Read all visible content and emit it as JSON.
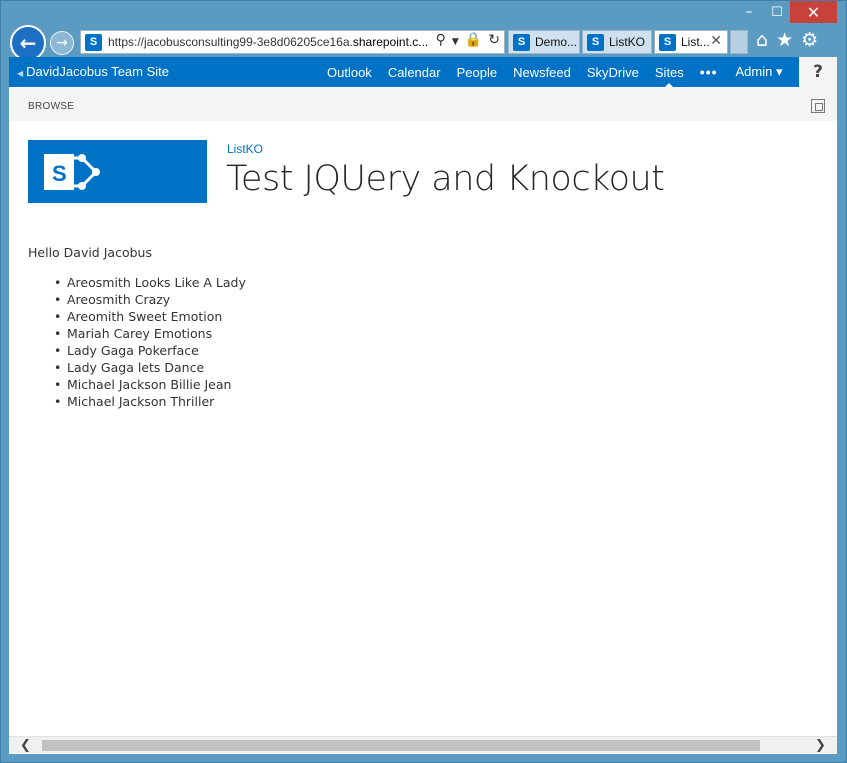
{
  "browser": {
    "window_controls": {
      "minimize": "–",
      "maximize": "☐",
      "close": "✕"
    },
    "address": {
      "url_prefix": "https://jacobusconsulting99-3e8d06205ce16a.",
      "url_host": "sharepoint.c..."
    },
    "tabs": [
      {
        "label": "Demo...",
        "active": false
      },
      {
        "label": "ListKO",
        "active": false
      },
      {
        "label": "List...",
        "active": true
      }
    ],
    "icons": {
      "back": "arrow-left-icon",
      "forward": "arrow-right-icon",
      "search": "search-icon",
      "lock": "lock-icon",
      "refresh": "refresh-icon",
      "home": "home-icon",
      "favorites": "star-icon",
      "tools": "gear-icon"
    }
  },
  "suite_bar": {
    "site_title": "DavidJacobus Team Site",
    "links": [
      "Outlook",
      "Calendar",
      "People",
      "Newsfeed",
      "SkyDrive",
      "Sites"
    ],
    "active_link": "Sites",
    "ellipsis": "•••",
    "admin_label": "Admin ▾",
    "help_label": "?"
  },
  "ribbon": {
    "tab_label": "BROWSE"
  },
  "page": {
    "breadcrumb": "ListKO",
    "title": "Test JQUery and Knockout",
    "greeting": "Hello David Jacobus",
    "songs": [
      "Areosmith Looks Like A Lady",
      "Areosmith Crazy",
      "Areomith Sweet Emotion",
      "Mariah Carey Emotions",
      "Lady Gaga Pokerface",
      "Lady Gaga lets Dance",
      "Michael Jackson Billie Jean",
      "Michael Jackson Thriller"
    ]
  },
  "scrollbar": {
    "left_arrow": "❮",
    "right_arrow": "❯"
  },
  "colors": {
    "frame": "#5b9bc2",
    "sharepoint_blue": "#0072c6",
    "close_red": "#c7423b",
    "ribbon_bg": "#f4f4f4"
  }
}
